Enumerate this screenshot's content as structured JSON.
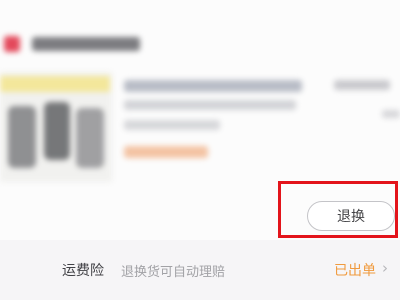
{
  "order": {
    "return_button_label": "退换"
  },
  "shipping_insurance": {
    "label": "运费险",
    "description": "退换货可自动理赔",
    "status": "已出单",
    "chevron_icon": "chevron-right-icon"
  },
  "colors": {
    "highlight_border": "#e3141b",
    "status_orange": "#f09a3e",
    "shop_icon": "#e3495b"
  }
}
